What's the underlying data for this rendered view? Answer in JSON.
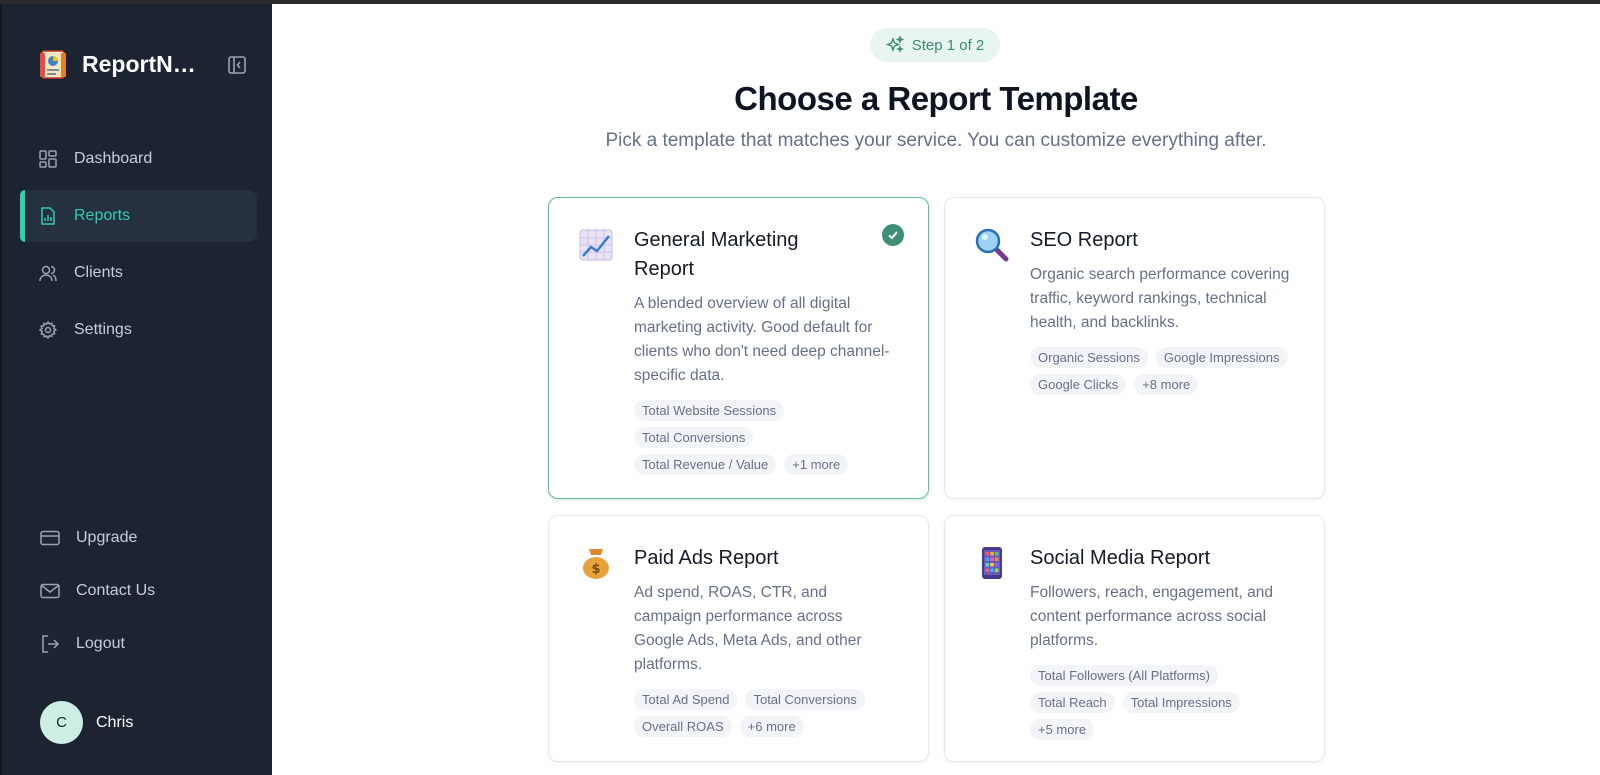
{
  "sidebar": {
    "brand_name": "ReportNe...",
    "nav": [
      {
        "label": "Dashboard",
        "icon": "dashboard-icon"
      },
      {
        "label": "Reports",
        "icon": "report-icon",
        "active": true
      },
      {
        "label": "Clients",
        "icon": "users-icon"
      },
      {
        "label": "Settings",
        "icon": "gear-icon"
      }
    ],
    "bottom": [
      {
        "label": "Upgrade",
        "icon": "credit-card-icon"
      },
      {
        "label": "Contact Us",
        "icon": "mail-icon"
      },
      {
        "label": "Logout",
        "icon": "logout-icon"
      }
    ],
    "user": {
      "initial": "C",
      "name": "Chris"
    }
  },
  "main": {
    "step": "Step 1 of 2",
    "title": "Choose a Report Template",
    "subtitle": "Pick a template that matches your service. You can customize everything after.",
    "templates": [
      {
        "title": "General Marketing Report",
        "icon": "chart-increasing-icon",
        "selected": true,
        "description": "A blended overview of all digital marketing activity. Good default for clients who don't need deep channel-specific data.",
        "tags": [
          "Total Website Sessions",
          "Total Conversions",
          "Total Revenue / Value",
          "+1 more"
        ]
      },
      {
        "title": "SEO Report",
        "icon": "magnifying-glass-icon",
        "selected": false,
        "description": "Organic search performance covering traffic, keyword rankings, technical health, and backlinks.",
        "tags": [
          "Organic Sessions",
          "Google Impressions",
          "Google Clicks",
          "+8 more"
        ]
      },
      {
        "title": "Paid Ads Report",
        "icon": "money-bag-icon",
        "selected": false,
        "description": "Ad spend, ROAS, CTR, and campaign performance across Google Ads, Meta Ads, and other platforms.",
        "tags": [
          "Total Ad Spend",
          "Total Conversions",
          "Overall ROAS",
          "+6 more"
        ]
      },
      {
        "title": "Social Media Report",
        "icon": "mobile-phone-icon",
        "selected": false,
        "description": "Followers, reach, engagement, and content performance across social platforms.",
        "tags": [
          "Total Followers (All Platforms)",
          "Total Reach",
          "Total Impressions",
          "+5 more"
        ]
      }
    ]
  },
  "colors": {
    "sidebar_bg": "#1c2432",
    "accent": "#2fd0b0",
    "selected_border": "#66b89c",
    "check_bg": "#3f8f78"
  }
}
